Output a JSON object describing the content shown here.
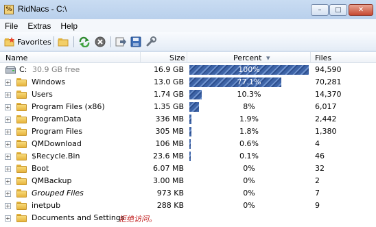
{
  "window": {
    "title": "RidNacs - C:\\",
    "app_icon": "%",
    "min_glyph": "–",
    "max_glyph": "□",
    "close_glyph": "✕"
  },
  "menu": [
    "File",
    "Extras",
    "Help"
  ],
  "toolbar": {
    "favorites_label": "Favorites"
  },
  "columns": {
    "name": "Name",
    "size": "Size",
    "percent": "Percent",
    "files": "Files",
    "sort_indicator": "▾"
  },
  "drive": {
    "label": "C:",
    "free": "30.9 GB free",
    "size": "16.9 GB",
    "percent": "100%",
    "percent_value": 100,
    "files": "94,590"
  },
  "rows": [
    {
      "name": "Windows",
      "size": "13.0 GB",
      "percent": "77.1%",
      "percent_value": 77.1,
      "files": "70,281"
    },
    {
      "name": "Users",
      "size": "1.74 GB",
      "percent": "10.3%",
      "percent_value": 10.3,
      "files": "14,370"
    },
    {
      "name": "Program Files (x86)",
      "size": "1.35 GB",
      "percent": "8%",
      "percent_value": 8,
      "files": "6,017"
    },
    {
      "name": "ProgramData",
      "size": "336 MB",
      "percent": "1.9%",
      "percent_value": 1.9,
      "files": "2,442"
    },
    {
      "name": "Program Files",
      "size": "305 MB",
      "percent": "1.8%",
      "percent_value": 1.8,
      "files": "1,380"
    },
    {
      "name": "QMDownload",
      "size": "106 MB",
      "percent": "0.6%",
      "percent_value": 0.6,
      "files": "4"
    },
    {
      "name": "$Recycle.Bin",
      "size": "23.6 MB",
      "percent": "0.1%",
      "percent_value": 0.1,
      "files": "46"
    },
    {
      "name": "Boot",
      "size": "6.07 MB",
      "percent": "0%",
      "percent_value": 0,
      "files": "32"
    },
    {
      "name": "QMBackup",
      "size": "3.00 MB",
      "percent": "0%",
      "percent_value": 0,
      "files": "2"
    },
    {
      "name": "Grouped Files",
      "size": "973 KB",
      "percent": "0%",
      "percent_value": 0,
      "files": "7",
      "italic": true
    },
    {
      "name": "inetpub",
      "size": "288 KB",
      "percent": "0%",
      "percent_value": 0,
      "files": "9"
    },
    {
      "name": "Documents and Settings",
      "size": "",
      "percent": "",
      "percent_value": 0,
      "files": "",
      "status": "拒绝访问。"
    }
  ]
}
